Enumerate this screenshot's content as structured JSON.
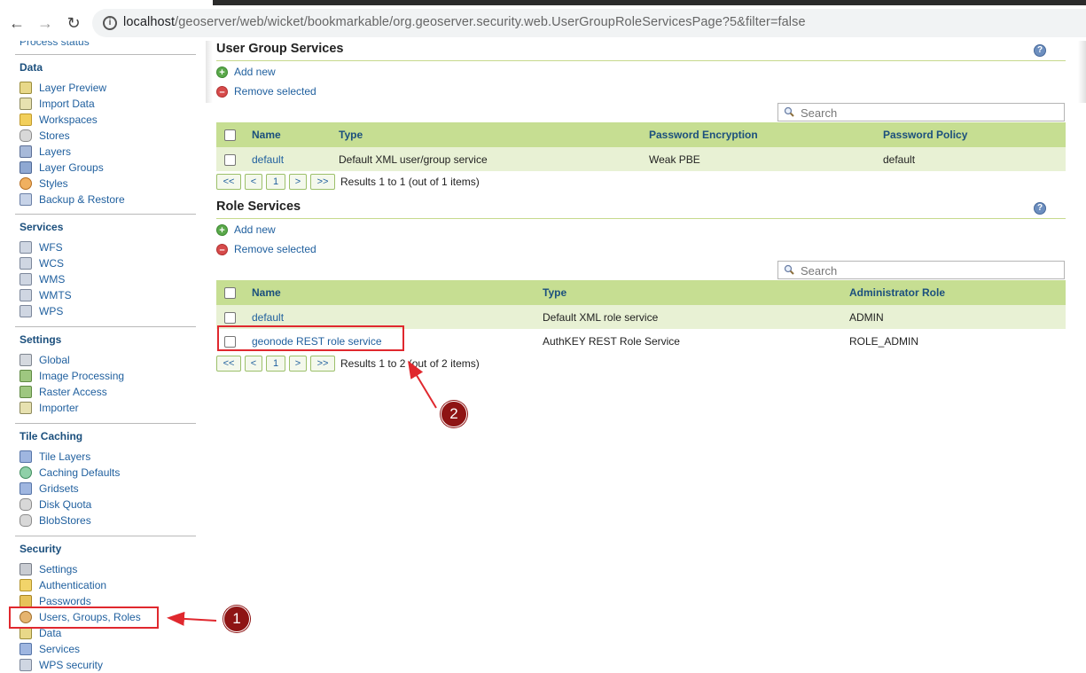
{
  "browser": {
    "url_host": "localhost",
    "url_path": "/geoserver/web/wicket/bookmarkable/org.geoserver.security.web.UserGroupRoleServicesPage?5&filter=false"
  },
  "sidebar": {
    "partial_item": "Process status",
    "sections": [
      {
        "title": "Data",
        "items": [
          "Layer Preview",
          "Import Data",
          "Workspaces",
          "Stores",
          "Layers",
          "Layer Groups",
          "Styles",
          "Backup & Restore"
        ]
      },
      {
        "title": "Services",
        "items": [
          "WFS",
          "WCS",
          "WMS",
          "WMTS",
          "WPS"
        ]
      },
      {
        "title": "Settings",
        "items": [
          "Global",
          "Image Processing",
          "Raster Access",
          "Importer"
        ]
      },
      {
        "title": "Tile Caching",
        "items": [
          "Tile Layers",
          "Caching Defaults",
          "Gridsets",
          "Disk Quota",
          "BlobStores"
        ]
      },
      {
        "title": "Security",
        "items": [
          "Settings",
          "Authentication",
          "Passwords",
          "Users, Groups, Roles",
          "Data",
          "Services",
          "WPS security"
        ]
      }
    ]
  },
  "user_group": {
    "title": "User Group Services",
    "add_label": "Add new",
    "remove_label": "Remove selected",
    "search_placeholder": "Search",
    "columns": [
      "Name",
      "Type",
      "Password Encryption",
      "Password Policy"
    ],
    "rows": [
      {
        "name": "default",
        "type": "Default XML user/group service",
        "encryption": "Weak PBE",
        "policy": "default"
      }
    ],
    "pager": {
      "first": "<<",
      "prev": "<",
      "page": "1",
      "next": ">",
      "last": ">>",
      "results": "Results 1 to 1 (out of 1 items)"
    }
  },
  "role": {
    "title": "Role Services",
    "add_label": "Add new",
    "remove_label": "Remove selected",
    "search_placeholder": "Search",
    "columns": [
      "Name",
      "Type",
      "Administrator Role"
    ],
    "rows": [
      {
        "name": "default",
        "type": "Default XML role service",
        "admin_role": "ADMIN"
      },
      {
        "name": "geonode REST role service",
        "type": "AuthKEY REST Role Service",
        "admin_role": "ROLE_ADMIN"
      }
    ],
    "pager": {
      "first": "<<",
      "prev": "<",
      "page": "1",
      "next": ">",
      "last": ">>",
      "results": "Results 1 to 2 (out of 2 items)"
    }
  },
  "annotations": {
    "badge1": "1",
    "badge2": "2",
    "color": "#e0282e",
    "badge_color": "#8e1414"
  }
}
